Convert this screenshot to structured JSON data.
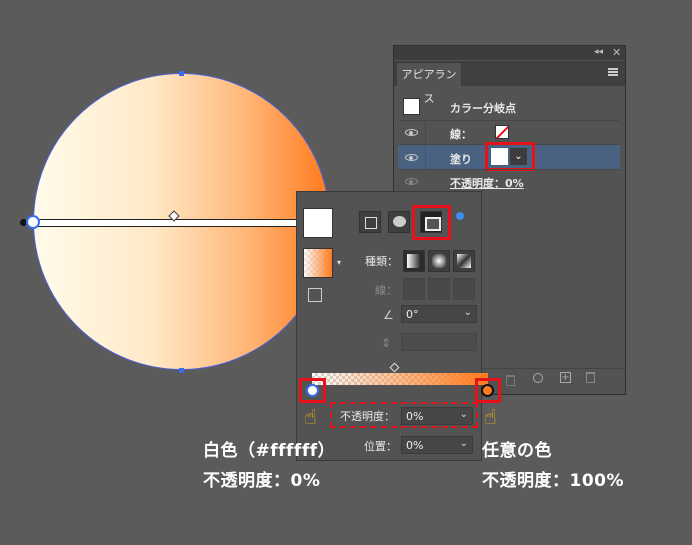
{
  "appearance_panel": {
    "tab": "アピアランス",
    "title": "カラー分岐点",
    "stroke_label": "線：",
    "fill_label": "塗り",
    "opacity_label": "不透明度：0%"
  },
  "gradient_panel": {
    "type_label": "種類：",
    "stroke_label": "線：",
    "angle_value": "0°",
    "opacity_label": "不透明度：",
    "opacity_value": "0%",
    "position_label": "位置：",
    "position_value": "0%"
  },
  "annotations": {
    "left_line1": "白色（#ffffff）",
    "left_line2": "不透明度：0%",
    "right_line1": "任意の色",
    "right_line2": "不透明度：100%"
  },
  "colors": {
    "highlight": "#e6121b",
    "gradient_start": "#ffffff",
    "gradient_end": "#ff7a1c",
    "selection": "#4a62d8"
  }
}
